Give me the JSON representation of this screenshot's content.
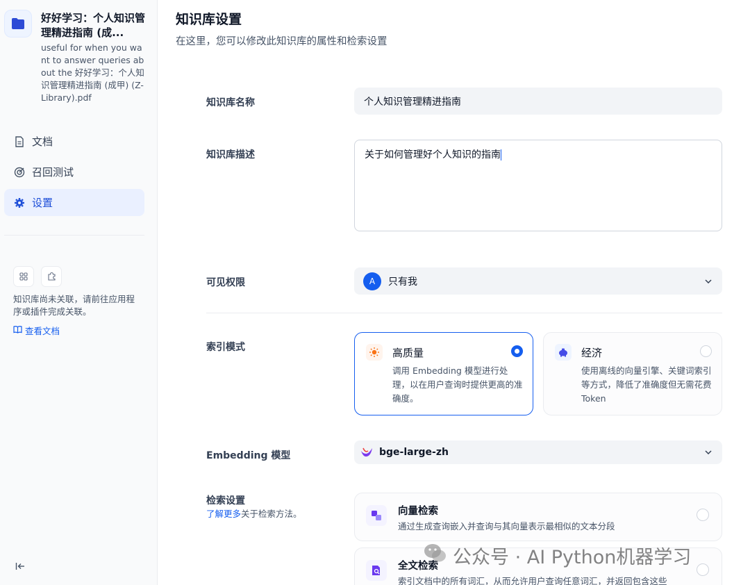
{
  "sidebar": {
    "kb_title": "好好学习：个人知识管理精进指南 (成...",
    "kb_description": "useful for when you want to answer queries about the 好好学习：个人知识管理精进指南 (成甲) (Z-Library).pdf",
    "nav": [
      {
        "label": "文档",
        "icon": "document-icon"
      },
      {
        "label": "召回测试",
        "icon": "target-icon"
      },
      {
        "label": "设置",
        "icon": "gear-icon",
        "active": true
      }
    ],
    "not_linked_text": "知识库尚未关联，请前往应用程序或插件完成关联。",
    "view_docs": "查看文档"
  },
  "main": {
    "title": "知识库设置",
    "subtitle": "在这里，您可以修改此知识库的属性和检索设置",
    "name_label": "知识库名称",
    "name_value": "个人知识管理精进指南",
    "desc_label": "知识库描述",
    "desc_value": "关于如何管理好个人知识的指南",
    "permission_label": "可见权限",
    "permission_avatar": "A",
    "permission_value": "只有我",
    "index_label": "索引模式",
    "index_modes": [
      {
        "title": "高质量",
        "desc": "调用 Embedding 模型进行处理，以在用户查询时提供更高的准确度。",
        "selected": true
      },
      {
        "title": "经济",
        "desc": "使用离线的向量引擎、关键词索引等方式，降低了准确度但无需花费 Token",
        "selected": false
      }
    ],
    "embedding_label": "Embedding 模型",
    "embedding_value": "bge-large-zh",
    "retrieval_label": "检索设置",
    "learn_more_link": "了解更多",
    "learn_more_suffix": "关于检索方法。",
    "retrieval_methods": [
      {
        "title": "向量检索",
        "desc": "通过生成查询嵌入并查询与其向量表示最相似的文本分段"
      },
      {
        "title": "全文检索",
        "desc": "索引文档中的所有词汇，从而允许用户查询任意词汇，并返回包含这些"
      }
    ]
  },
  "watermark": "公众号 · AI Python机器学习",
  "colors": {
    "accent": "#155eef",
    "active_bg": "#eaf0ff",
    "sidebar_bg": "#f9fafb"
  }
}
